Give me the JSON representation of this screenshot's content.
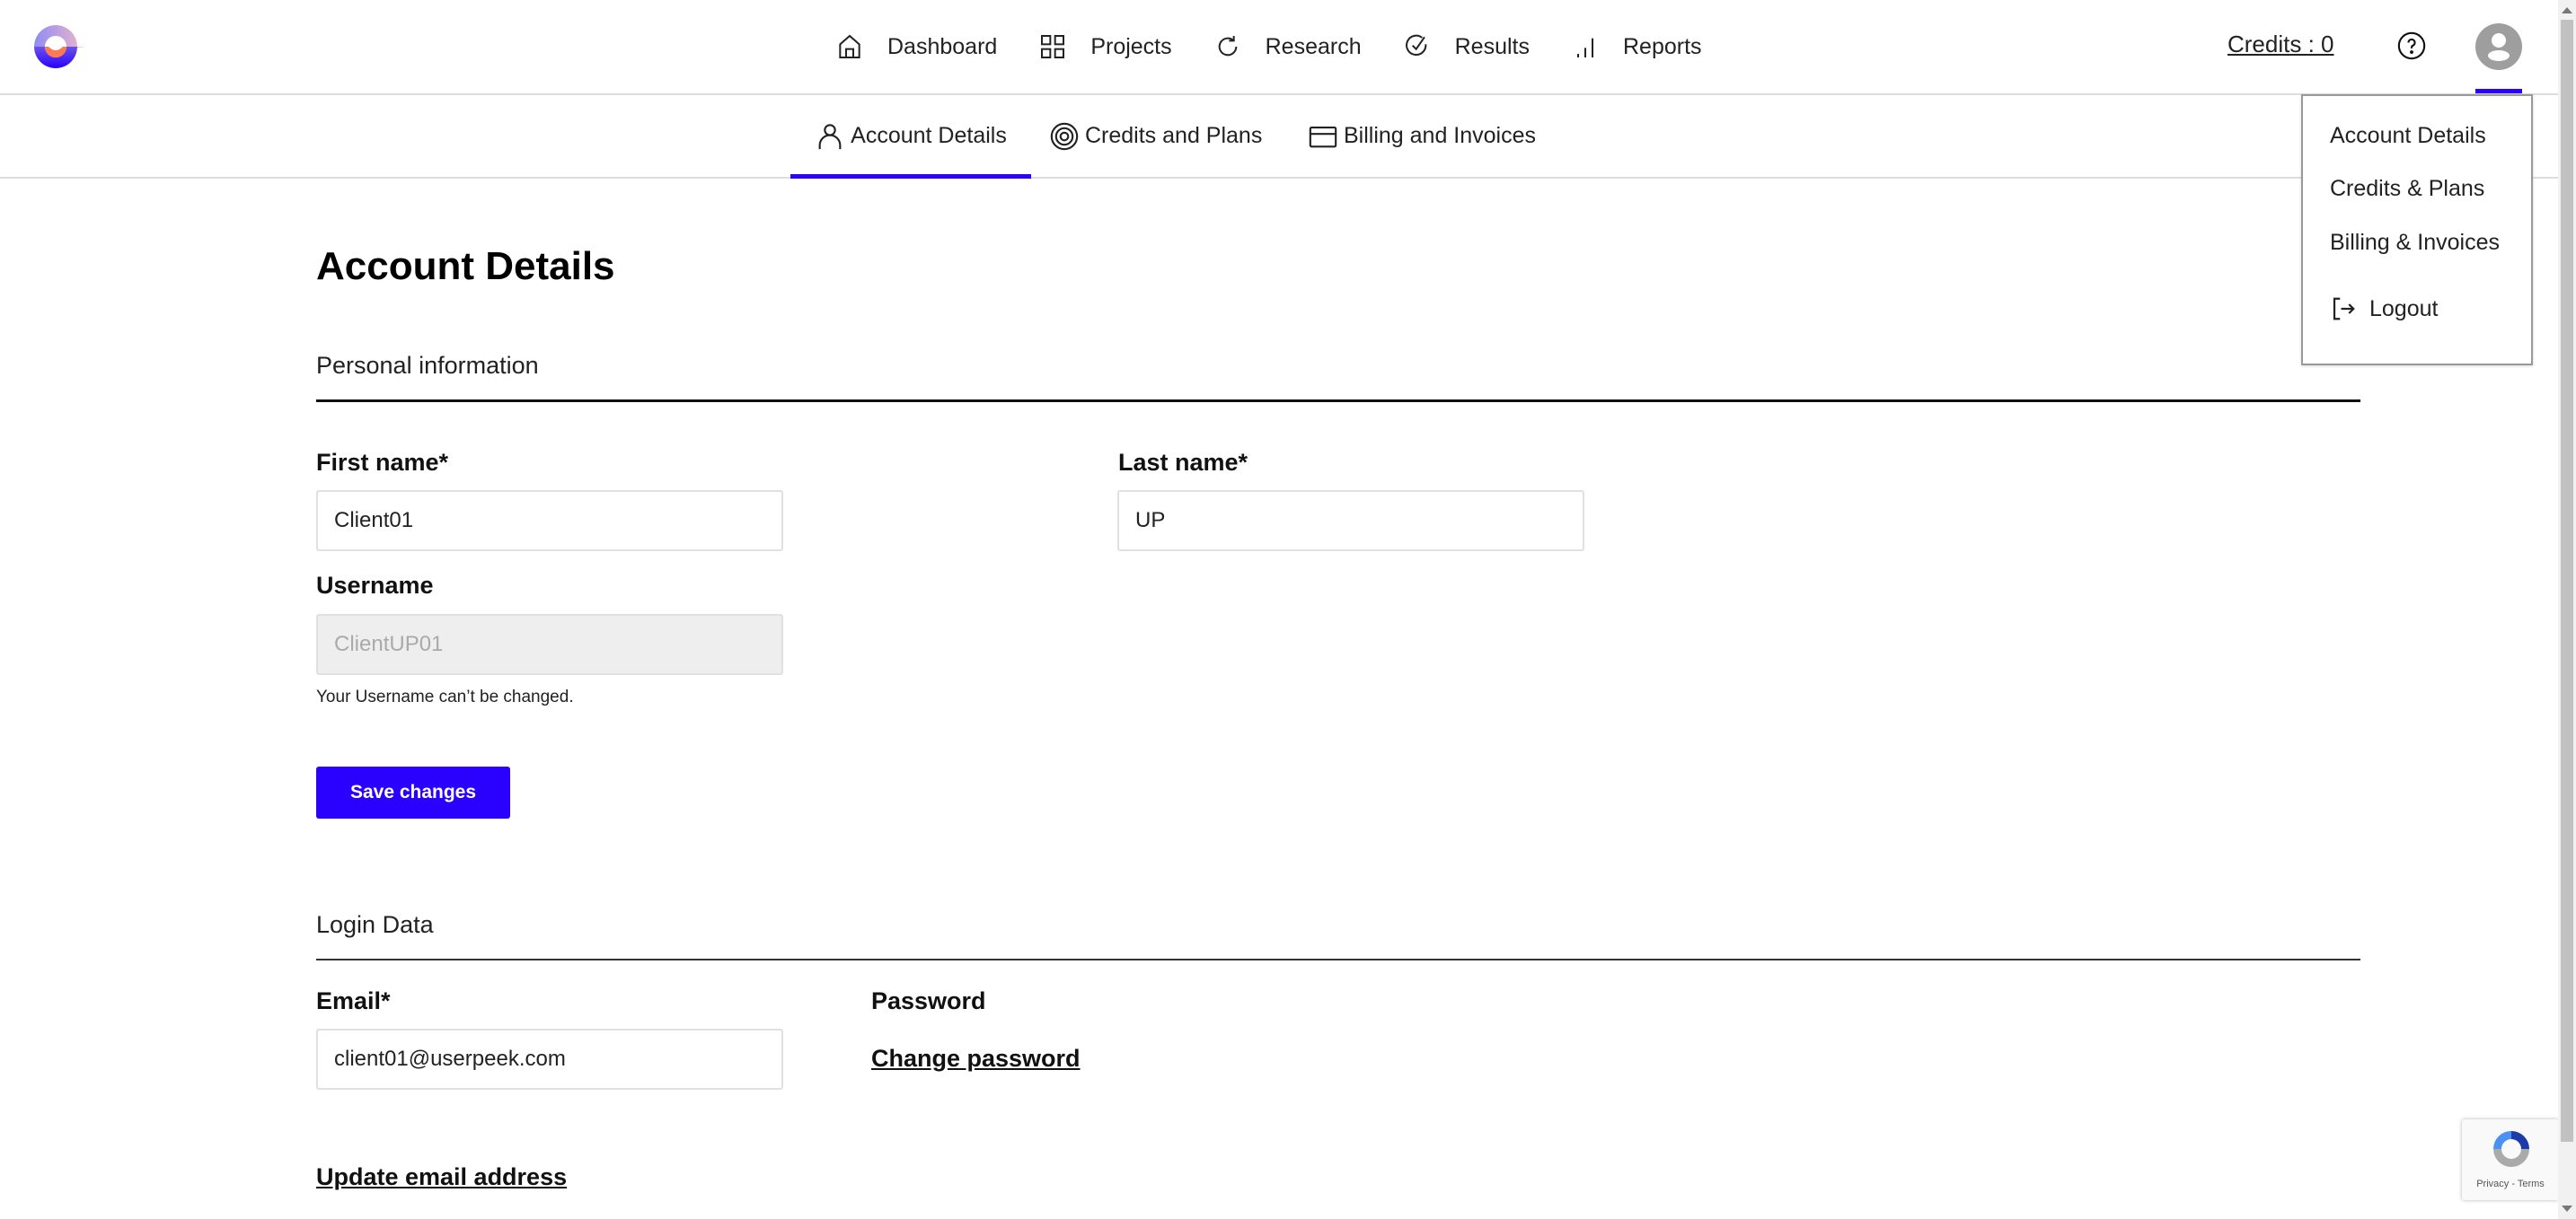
{
  "header": {
    "logo": "userpeek-logo",
    "nav": [
      {
        "label": "Dashboard",
        "icon": "home-icon"
      },
      {
        "label": "Projects",
        "icon": "grid-icon"
      },
      {
        "label": "Research",
        "icon": "refresh-icon"
      },
      {
        "label": "Results",
        "icon": "check-circle-icon"
      },
      {
        "label": "Reports",
        "icon": "bar-chart-icon"
      }
    ],
    "credits_label": "Credits : 0",
    "help_icon": "help-icon",
    "avatar_icon": "user-avatar-icon"
  },
  "tabs": [
    {
      "label": "Account Details",
      "icon": "user-icon",
      "active": true
    },
    {
      "label": "Credits and Plans",
      "icon": "target-icon",
      "active": false
    },
    {
      "label": "Billing and Invoices",
      "icon": "credit-card-icon",
      "active": false
    }
  ],
  "page": {
    "title": "Account Details",
    "personal_section": "Personal information",
    "first_name_label": "First name*",
    "first_name_value": "Client01",
    "last_name_label": "Last name*",
    "last_name_value": "UP",
    "username_label": "Username",
    "username_value": "ClientUP01",
    "username_hint": "Your Username can’t be changed.",
    "save_button": "Save changes",
    "login_section": "Login Data",
    "email_label": "Email*",
    "email_value": "client01@userpeek.com",
    "password_label": "Password",
    "change_password_link": "Change password",
    "update_email_link": "Update email address"
  },
  "dropdown": {
    "items": [
      "Account Details",
      "Credits & Plans",
      "Billing & Invoices"
    ],
    "logout": "Logout"
  },
  "recaptcha": {
    "text": "Privacy - Terms"
  },
  "colors": {
    "accent": "#2a00ff"
  }
}
